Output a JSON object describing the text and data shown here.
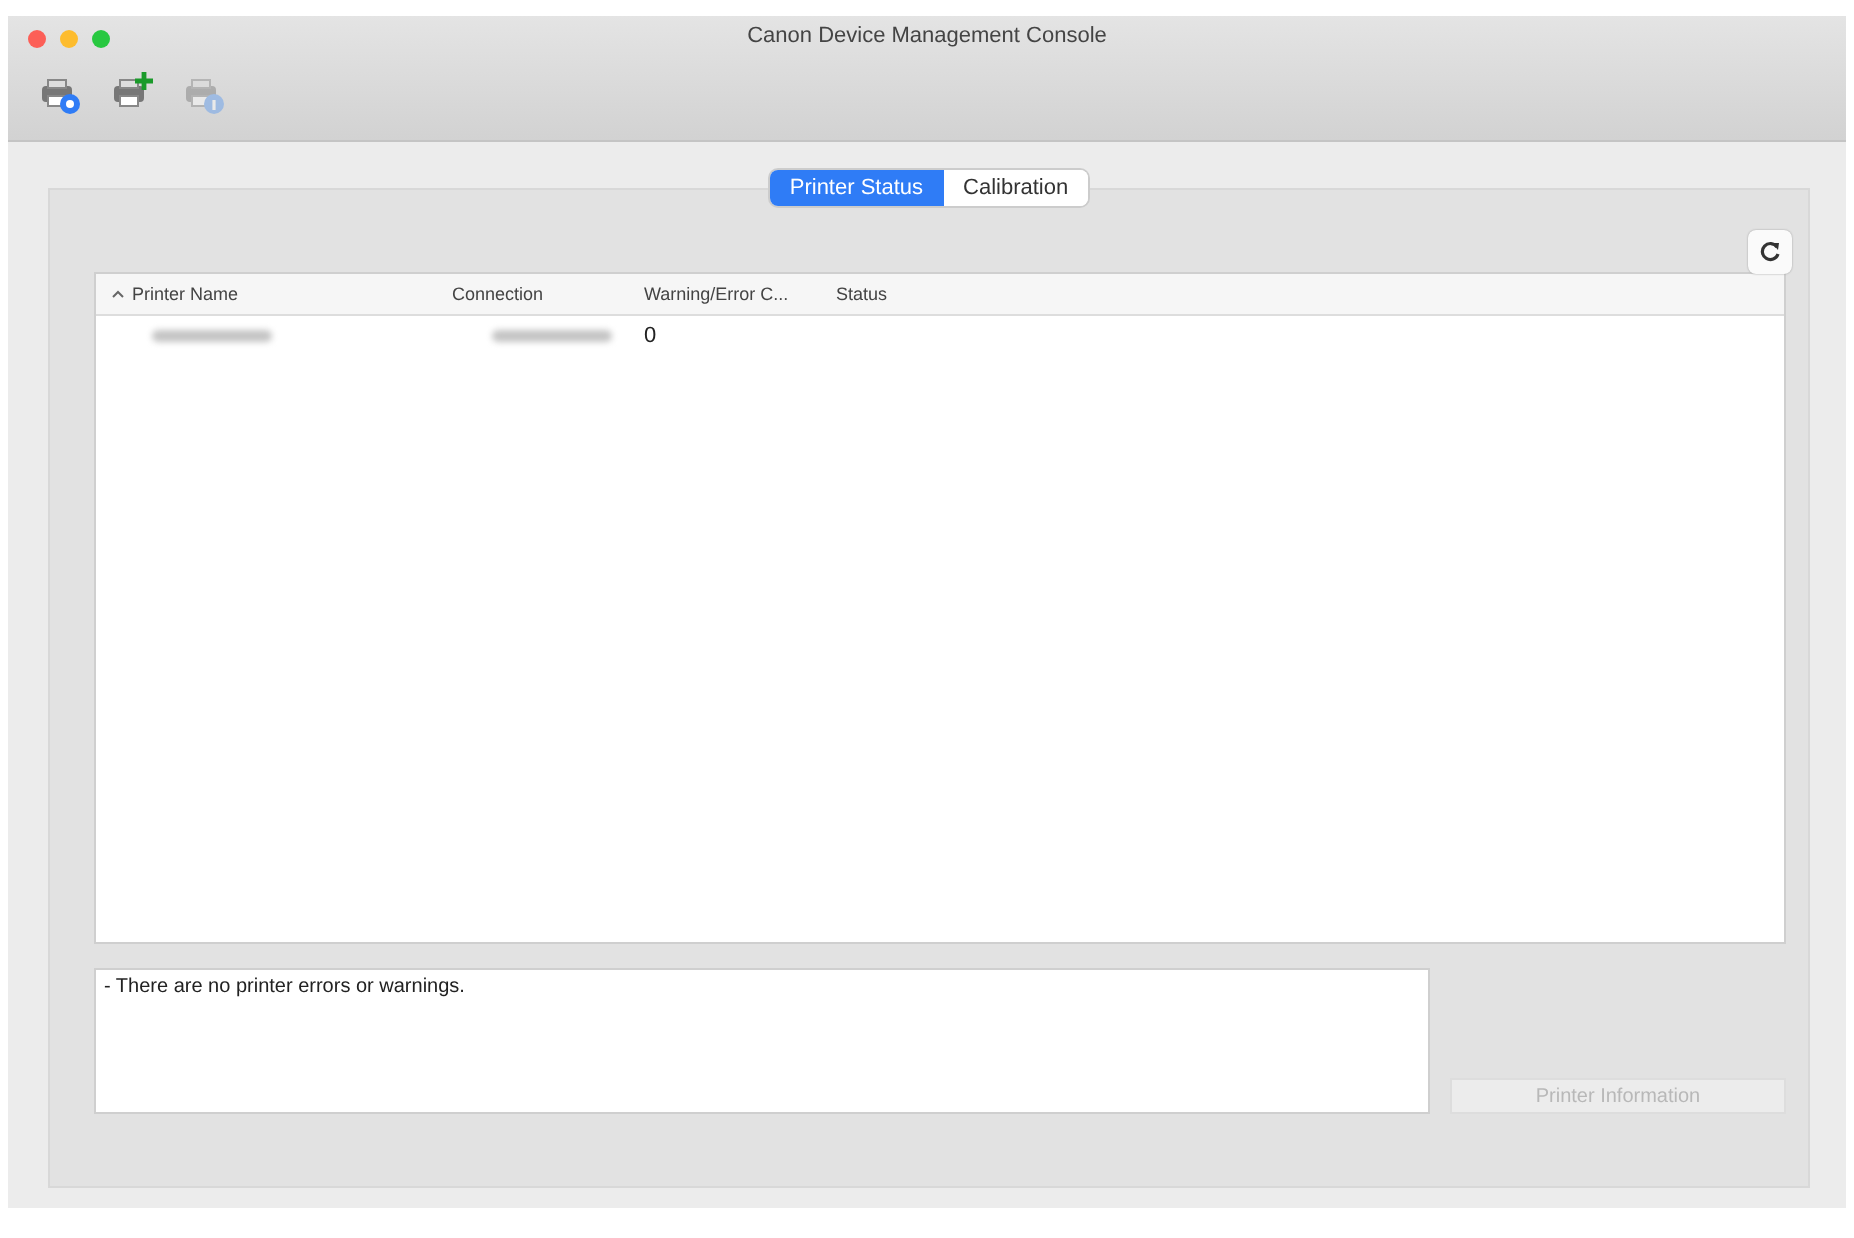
{
  "window": {
    "title": "Canon Device Management Console"
  },
  "toolbar": [
    {
      "kind": "settings",
      "disabled": false
    },
    {
      "kind": "add",
      "disabled": false
    },
    {
      "kind": "info",
      "disabled": true
    }
  ],
  "tabs": [
    {
      "label": "Printer Status",
      "selected": true
    },
    {
      "label": "Calibration",
      "selected": false
    }
  ],
  "table": {
    "columns": [
      {
        "label": "Printer Name",
        "sorted": true
      },
      {
        "label": "Connection",
        "sorted": false
      },
      {
        "label": "Warning/Error C...",
        "sorted": false
      },
      {
        "label": "Status",
        "sorted": false
      }
    ],
    "rows": [
      {
        "cells": [
          {
            "kind": "blurred"
          },
          {
            "kind": "blurred"
          },
          {
            "kind": "text",
            "text": "0"
          },
          {
            "kind": "text",
            "text": ""
          }
        ]
      }
    ]
  },
  "message": "- There are no printer errors or warnings.",
  "info_button": {
    "label": "Printer Information",
    "disabled": true
  }
}
